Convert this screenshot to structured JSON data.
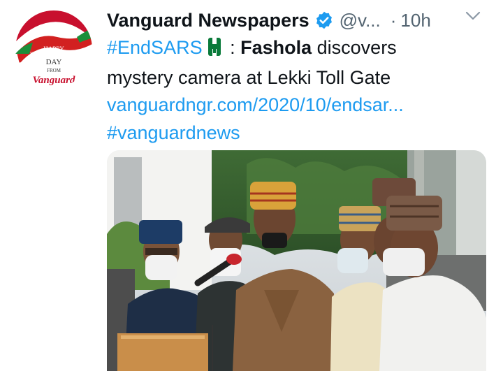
{
  "tweet": {
    "avatar": {
      "icon": "vanguard-independence-day-logo-icon",
      "line1": "HAPPY",
      "line2": "INDEPENDENCE",
      "line3": "DAY",
      "line4": "FROM",
      "wordmark": "Vanguard"
    },
    "display_name": "Vanguard Newspapers",
    "handle": "@v...",
    "separator": "·",
    "time": "10h",
    "hashtag1": "#EndSARS",
    "colon": " : ",
    "bold_name": "Fashola",
    "text_rest": " discovers",
    "line2": "mystery camera at Lekki Toll Gate",
    "url": "vanguardngr.com/2020/10/endsar...",
    "hashtag2": "#vanguardnews",
    "icons": {
      "verified": "verified-badge-icon",
      "more": "chevron-down-icon",
      "flag": "nigeria-fist-emoji-icon"
    },
    "colors": {
      "link": "#1d9bf0",
      "text": "#0f1419",
      "muted": "#536471"
    }
  }
}
